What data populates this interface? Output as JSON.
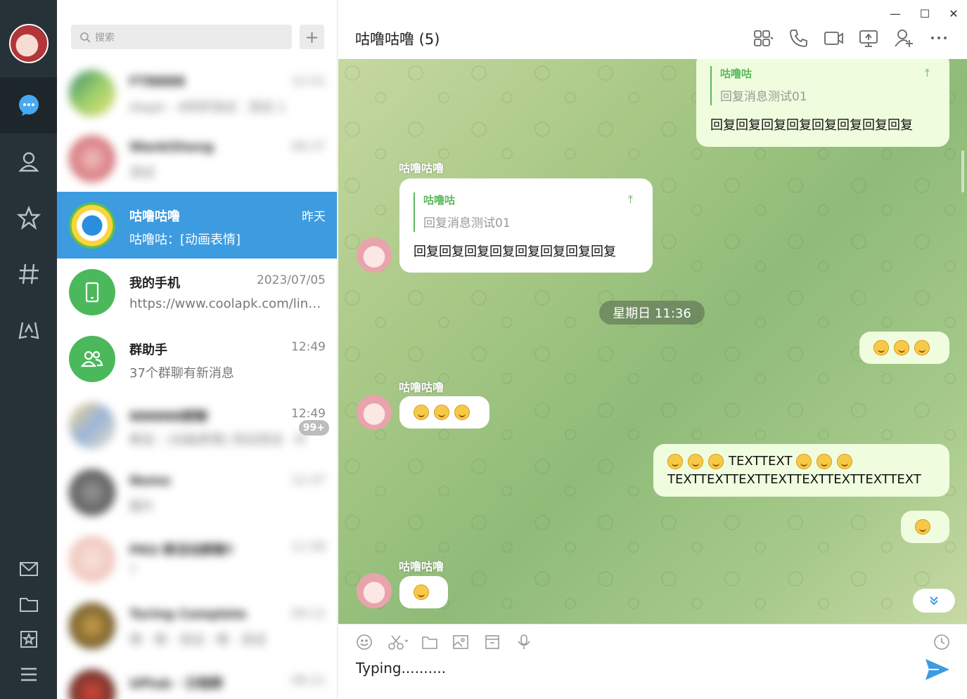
{
  "sidebar": {
    "items": [
      {
        "icon": "message-icon",
        "active": true
      },
      {
        "icon": "contacts-icon"
      },
      {
        "icon": "star-icon"
      },
      {
        "icon": "hash-icon"
      },
      {
        "icon": "games-icon"
      }
    ],
    "bottom_items": [
      {
        "icon": "mail-icon"
      },
      {
        "icon": "folder-icon"
      },
      {
        "icon": "favorites-icon"
      },
      {
        "icon": "menu-icon"
      }
    ]
  },
  "search": {
    "placeholder": "搜索",
    "add_label": "+"
  },
  "conversations": [
    {
      "name": "FTBBBB",
      "time": "12:51",
      "preview": "Aleph · 4阿杯测试 · 测试 1",
      "blurred": true
    },
    {
      "name": "WankSheng",
      "time": "08:37",
      "preview": "测试",
      "blurred": true
    },
    {
      "name": "咕噜咕噜",
      "time": "昨天",
      "preview": "咕噜咕：[动画表情]",
      "active": true
    },
    {
      "name": "我的手机",
      "time": "2023/07/05",
      "preview": "https://www.coolapk.com/link?url=..."
    },
    {
      "name": "群助手",
      "time": "12:49",
      "preview": "37个群聊有新消息"
    },
    {
      "name": "NNNNN群聊",
      "time": "12:49",
      "preview": "群友：[动画表情] 测试测试 · 片",
      "badge": "99+",
      "blurred": true
    },
    {
      "name": "Nemo",
      "time": "12:37",
      "preview": "图片",
      "blurred": true
    },
    {
      "name": "PKU 群活动群聊?",
      "time": "11:58",
      "preview": "?",
      "blurred": true
    },
    {
      "name": "Turing Complete",
      "time": "09:12",
      "preview": "嗯 · 嗯 · 测试 · 嗯 · 测试",
      "blurred": true
    },
    {
      "name": "UPlub · 日程群",
      "time": "08:21",
      "preview": "...",
      "blurred": true
    }
  ],
  "chat": {
    "title": "咕噜咕噜 (5)",
    "window_controls": {
      "minimize": "—",
      "maximize": "☐",
      "close": "✕"
    },
    "header_icons": [
      "apps-icon",
      "phone-icon",
      "video-icon",
      "screen-share-icon",
      "add-member-icon",
      "more-icon"
    ],
    "date_separator": "星期日 11:36",
    "messages": [
      {
        "direction": "out",
        "quote_name": "咕噜咕",
        "quote_text": "回复消息测试01",
        "text": "回复回复回复回复回复回复回复回复"
      },
      {
        "direction": "in",
        "sender": "咕噜咕噜",
        "quote_name": "咕噜咕",
        "quote_text": "回复消息测试01",
        "text": "回复回复回复回复回复回复回复回复"
      },
      {
        "direction": "out",
        "emoji_count": 3
      },
      {
        "direction": "in",
        "sender": "咕噜咕噜",
        "emoji_count": 3
      },
      {
        "direction": "out",
        "line1": "TEXTTEXT",
        "line2": "TEXTTEXTTEXTTEXTTEXTTEXTTEXTTEXT"
      },
      {
        "direction": "out",
        "emoji_count": 1
      },
      {
        "direction": "in",
        "sender": "咕噜咕噜",
        "emoji_count": 1
      }
    ]
  },
  "composer": {
    "text": "Typing..........",
    "tools": [
      "emoji-icon",
      "scissors-icon",
      "folder-icon",
      "image-icon",
      "gift-icon",
      "microphone-icon",
      "history-icon"
    ]
  },
  "colors": {
    "rail": "#263238",
    "accent": "#3d9be0",
    "outgoing_bubble": "#effcde",
    "quote_green": "#5cb85c",
    "send_blue": "#3d9be0"
  }
}
